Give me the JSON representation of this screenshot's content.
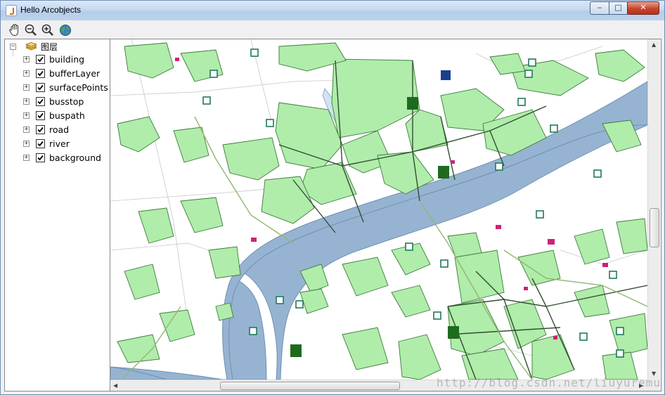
{
  "window": {
    "title": "Hello Arcobjects",
    "minimize_glyph": "‒",
    "maximize_glyph": "□",
    "close_glyph": "✕"
  },
  "toolbar": {
    "tools": [
      {
        "name": "pan-tool",
        "icon": "hand-icon"
      },
      {
        "name": "zoom-out-tool",
        "icon": "zoom-out-icon"
      },
      {
        "name": "zoom-in-tool",
        "icon": "zoom-in-icon"
      },
      {
        "name": "full-extent-tool",
        "icon": "globe-icon"
      }
    ]
  },
  "toc": {
    "root_label": "图层",
    "root_icon": "layers-icon",
    "layers": [
      {
        "label": "building",
        "checked": true
      },
      {
        "label": "bufferLayer",
        "checked": true
      },
      {
        "label": "surfacePoints",
        "checked": true
      },
      {
        "label": "busstop",
        "checked": true
      },
      {
        "label": "buspath",
        "checked": true
      },
      {
        "label": "road",
        "checked": true
      },
      {
        "label": "river",
        "checked": true
      },
      {
        "label": "background",
        "checked": true
      }
    ]
  },
  "map": {
    "colors": {
      "land": "#ffffff",
      "river": "#96b4d2",
      "river_edge": "#6f8fb0",
      "building_fill": "#b0ecaa",
      "building_edge": "#3b7a3b",
      "road": "#2f4f2f",
      "buspath": "#8fb86f",
      "busstop": "#1f7a5a",
      "surface_point": "#cc2277"
    }
  },
  "watermark": "http://blog.csdn.net/liuyuremu",
  "scrollbars": {
    "h_grip": "|||",
    "v_grip": "≡"
  }
}
